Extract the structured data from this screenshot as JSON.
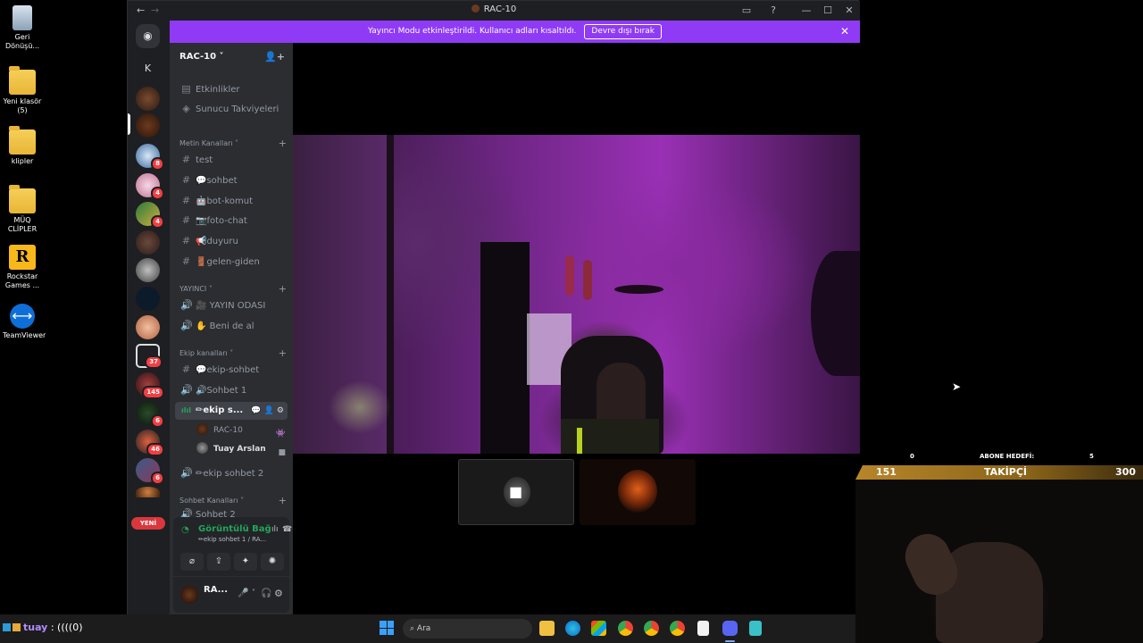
{
  "desktop": {
    "icons": [
      {
        "label": "Geri Dönüşü..."
      },
      {
        "label": "Yeni klasör (5)"
      },
      {
        "label": "klipler"
      },
      {
        "label": "MÜQ CLİPLER"
      },
      {
        "label": "Rockstar Games ..."
      },
      {
        "label": "TeamViewer"
      }
    ]
  },
  "window": {
    "title": "RAC-10",
    "nav_back": "←",
    "nav_fwd": "→",
    "inbox_icon": "▭",
    "help_icon": "?",
    "min": "—",
    "max": "☐",
    "close": "✕"
  },
  "banner": {
    "text": "Yayıncı Modu etkinleştirildi. Kullanıcı adları kısaltıldı.",
    "button": "Devre dışı bırak",
    "close": "✕"
  },
  "rail": {
    "home_glyph": "◉",
    "k_label": "K",
    "badges": [
      "8",
      "4",
      "4",
      "37",
      "145",
      "6",
      "46",
      "6",
      "6"
    ],
    "new_label": "YENİ"
  },
  "sidebar": {
    "server_name": "RAC-10 ˅",
    "invite_icon": "👤+",
    "top": [
      {
        "icon": "▤",
        "label": "Etkinlikler"
      },
      {
        "icon": "◈",
        "label": "Sunucu Takviyeleri"
      }
    ],
    "categories": {
      "metin": "Metin Kanalları ˅",
      "yayinci": "YAYINCI ˅",
      "ekip": "Ekip kanalları ˅",
      "sohbet": "Sohbet Kanalları ˅"
    },
    "channels_metin": [
      {
        "icon": "#",
        "label": "test"
      },
      {
        "icon": "#",
        "label": "💬sohbet"
      },
      {
        "icon": "#",
        "label": "🤖bot-komut"
      },
      {
        "icon": "#",
        "label": "📷foto-chat"
      },
      {
        "icon": "#",
        "label": "📢duyuru"
      },
      {
        "icon": "#",
        "label": "🚪gelen-giden"
      }
    ],
    "channels_yayinci": [
      {
        "icon": "🔊",
        "label": "🎥 YAYIN ODASI"
      },
      {
        "icon": "🔊",
        "label": "✋ Beni de al"
      }
    ],
    "channels_ekip": [
      {
        "icon": "#",
        "label": "💬ekip-sohbet"
      },
      {
        "icon": "🔊",
        "label": "🔊Sohbet 1"
      },
      {
        "icon": "ılıl",
        "label": "✏ekip s..."
      }
    ],
    "voice_users": [
      {
        "name": "RAC-10"
      },
      {
        "name": "Tuay Arslan"
      }
    ],
    "channel_after": {
      "icon": "🔊",
      "label": "✏ekip sohbet 2"
    },
    "channel_cut": {
      "icon": "🔊",
      "label": "Sohbet 2"
    }
  },
  "voice_panel": {
    "status": "Görüntülü Bağlantı",
    "subtitle": "✏ekip sohbet 1 / RA...",
    "buttons": [
      "⌀",
      "⇪",
      "✦",
      "✺"
    ]
  },
  "user_panel": {
    "name": "RA...",
    "mic": "🎤",
    "headset": "🎧",
    "settings": "⚙"
  },
  "stream_overlay": {
    "camera_icon": "■"
  },
  "overlay": {
    "left_small": "0",
    "goal_label": "ABONE HEDEFİ:",
    "right_small": "5",
    "left_value": "151",
    "center_label": "TAKİPÇİ",
    "right_value": "300"
  },
  "taskbar": {
    "chat_name": "tuay",
    "chat_text": " : ((((0)",
    "search_placeholder": "Ara",
    "search_icon": "⌕"
  }
}
